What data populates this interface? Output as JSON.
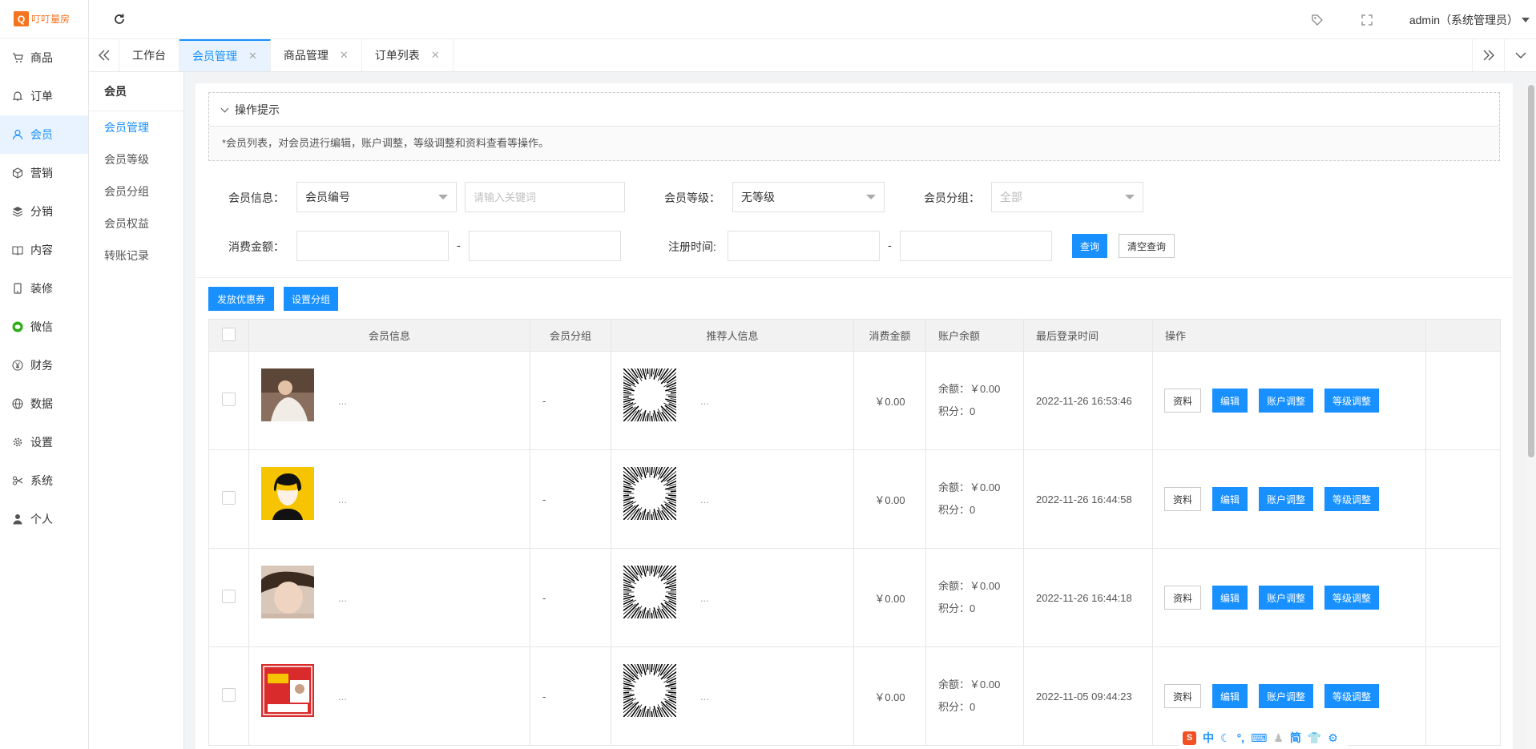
{
  "logo": {
    "mark": "Q",
    "text": "叮叮量房",
    "color": "#f5741f"
  },
  "nav": [
    {
      "label": "商品",
      "icon": "cart-icon"
    },
    {
      "label": "订单",
      "icon": "bell-icon"
    },
    {
      "label": "会员",
      "icon": "user-icon",
      "active": true
    },
    {
      "label": "营销",
      "icon": "cube-icon"
    },
    {
      "label": "分销",
      "icon": "layers-icon"
    },
    {
      "label": "内容",
      "icon": "book-icon"
    },
    {
      "label": "装修",
      "icon": "tablet-icon"
    },
    {
      "label": "微信",
      "icon": "wechat-icon"
    },
    {
      "label": "财务",
      "icon": "yen-icon"
    },
    {
      "label": "数据",
      "icon": "globe-icon"
    },
    {
      "label": "设置",
      "icon": "gear-icon"
    },
    {
      "label": "系统",
      "icon": "scissors-icon"
    },
    {
      "label": "个人",
      "icon": "person-icon"
    }
  ],
  "topbar": {
    "user": "admin（系统管理员）"
  },
  "tabs": [
    {
      "label": "工作台",
      "closable": false
    },
    {
      "label": "会员管理",
      "closable": true,
      "active": true
    },
    {
      "label": "商品管理",
      "closable": true
    },
    {
      "label": "订单列表",
      "closable": true
    }
  ],
  "submenu": {
    "title": "会员",
    "items": [
      "会员管理",
      "会员等级",
      "会员分组",
      "会员权益",
      "转账记录"
    ]
  },
  "tips": {
    "title": "操作提示",
    "text": "*会员列表，对会员进行编辑，账户调整，等级调整和资料查看等操作。"
  },
  "filters": {
    "member_info_label": "会员信息：",
    "member_info_select": "会员编号",
    "keyword_placeholder": "请输入关键词",
    "level_label": "会员等级：",
    "level_select": "无等级",
    "group_label": "会员分组：",
    "group_select": "全部",
    "amount_label": "消费金额：",
    "amount_sep": "-",
    "reg_label": "注册时间:",
    "reg_sep": "-",
    "search_button": "查询",
    "clear_button": "清空查询"
  },
  "actions": {
    "coupon_button": "发放优惠券",
    "group_button": "设置分组"
  },
  "table": {
    "headers": [
      "会员信息",
      "会员分组",
      "推荐人信息",
      "消费金额",
      "账户余额",
      "最后登录时间",
      "操作"
    ],
    "rows": [
      {
        "name": "...",
        "group": "-",
        "referrer": "...",
        "amount": "￥0.00",
        "balance": "余额：￥0.00",
        "points": "积分：0",
        "last_login": "2022-11-26 16:53:46"
      },
      {
        "name": "...",
        "group": "-",
        "referrer": "...",
        "amount": "￥0.00",
        "balance": "余额：￥0.00",
        "points": "积分：0",
        "last_login": "2022-11-26 16:44:58"
      },
      {
        "name": "...",
        "group": "-",
        "referrer": "...",
        "amount": "￥0.00",
        "balance": "余额：￥0.00",
        "points": "积分：0",
        "last_login": "2022-11-26 16:44:18"
      },
      {
        "name": "...",
        "group": "-",
        "referrer": "...",
        "amount": "￥0.00",
        "balance": "余额：￥0.00",
        "points": "积分：0",
        "last_login": "2022-11-05 09:44:23"
      }
    ],
    "op_labels": {
      "info": "资料",
      "edit": "编辑",
      "account": "账户调整",
      "level": "等级调整"
    }
  },
  "ime": {
    "lang": "中",
    "mode": "简"
  },
  "colors": {
    "primary": "#1890ff",
    "accent": "#f5741f",
    "active_bg": "#e8f3ff"
  }
}
